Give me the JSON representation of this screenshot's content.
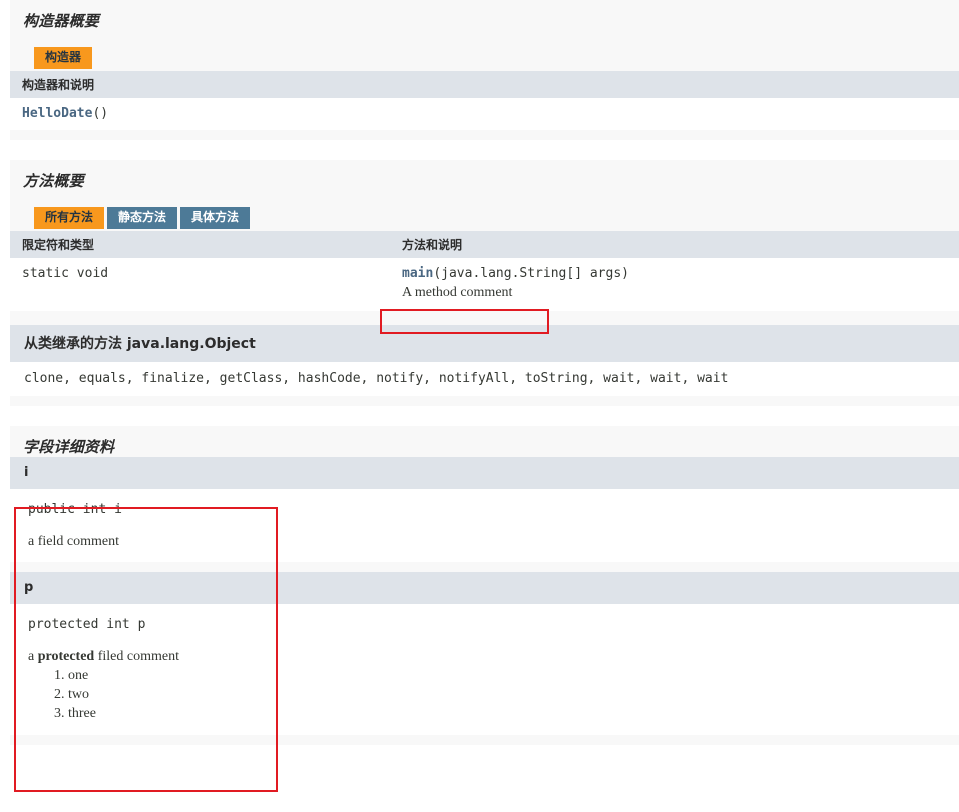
{
  "constructor_section": {
    "heading": "构造器概要",
    "tabs": [
      {
        "label": "构造器",
        "active": true
      }
    ],
    "column_header": "构造器和说明",
    "rows": [
      {
        "link_text": "HelloDate",
        "suffix": "()"
      }
    ]
  },
  "method_section": {
    "heading": "方法概要",
    "tabs": [
      {
        "label": "所有方法",
        "active": true
      },
      {
        "label": "静态方法",
        "active": false
      },
      {
        "label": "具体方法",
        "active": false
      }
    ],
    "column_headers": [
      "限定符和类型",
      "方法和说明"
    ],
    "rows": [
      {
        "modifier": "static void",
        "link_text": "main",
        "signature_suffix": "(java.lang.String[] args)",
        "description": "A method comment",
        "description_highlighted": true
      }
    ],
    "inherited": {
      "label_prefix": "从类继承的方法",
      "class_name": "java.lang.Object",
      "methods": "clone, equals, finalize, getClass, hashCode, notify, notifyAll, toString, wait, wait, wait"
    }
  },
  "field_detail_section": {
    "heading": "字段详细资料",
    "fields": [
      {
        "name": "i",
        "signature": "public int i",
        "comment_prefix": "a field comment",
        "comment_bold": "",
        "comment_suffix": "",
        "list_items": []
      },
      {
        "name": "p",
        "signature": "protected int p",
        "comment_prefix": "a ",
        "comment_bold": "protected",
        "comment_suffix": " filed comment",
        "list_items": [
          "one",
          "two",
          "three"
        ]
      }
    ]
  },
  "annotations": {
    "method_comment_box": "highlight-method-comment",
    "field_detail_box": "highlight-field-detail"
  },
  "colors": {
    "tab_active": "#F8981D",
    "tab_inactive": "#4D7A97",
    "table_header": "#dee3e9",
    "link": "#4A6782",
    "annotation": "#e11b22",
    "block_bg": "#f8f8f8"
  }
}
